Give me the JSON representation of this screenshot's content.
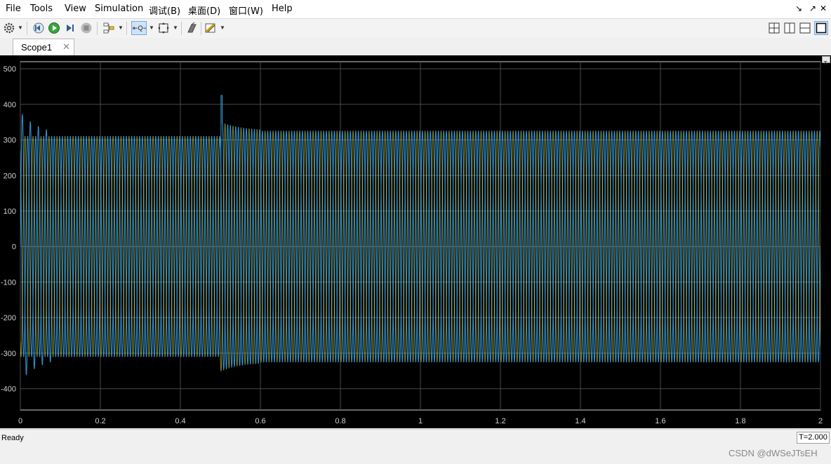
{
  "menu": [
    "File",
    "Tools",
    "View",
    "Simulation",
    "调试(B)",
    "桌面(D)",
    "窗口(W)",
    "Help"
  ],
  "window_controls": {
    "dock": "↘",
    "undock": "↗",
    "close": "✕"
  },
  "tab": {
    "label": "Scope1",
    "close": "✕"
  },
  "toolbar": {
    "icons": [
      "gear-icon",
      "step-back-icon",
      "run-icon",
      "step-forward-icon",
      "stop-icon",
      "signal-select-icon",
      "zoom-icon",
      "fit-to-view-icon",
      "highlight-block-icon",
      "measurements-icon"
    ],
    "layout_icons": [
      "layout-grid-icon",
      "layout-columns-icon",
      "layout-rows-icon",
      "layout-single-icon"
    ]
  },
  "status": {
    "text": "Ready",
    "time": "T=2.000"
  },
  "watermark": "CSDN @dWSeJTsEH",
  "colors": {
    "background": "#000000",
    "grid": "#4a4a4a",
    "axes_text": "#d0d0d0",
    "series_blue": "#3a9de0",
    "series_yellow": "#e8e040",
    "frame": "#f0f0f0"
  },
  "chart_data": {
    "type": "line",
    "title": "",
    "xlabel": "",
    "ylabel": "",
    "xlim": [
      0,
      2
    ],
    "ylim": [
      -460,
      520
    ],
    "xticks": [
      0,
      0.2,
      0.4,
      0.6,
      0.8,
      1,
      1.2,
      1.4,
      1.6,
      1.8,
      2
    ],
    "xtick_labels": [
      "0",
      "0.2",
      "0.4",
      "0.6",
      "0.8",
      "1",
      "1.2",
      "1.4",
      "1.6",
      "1.8",
      "2"
    ],
    "yticks": [
      500,
      400,
      300,
      200,
      100,
      0,
      -100,
      -200,
      -300,
      -400
    ],
    "ytick_labels": [
      "500",
      "400",
      "300",
      "200",
      "100",
      "0",
      "-100",
      "-200",
      "-300",
      "-400"
    ],
    "grid": true,
    "legend": "none",
    "series": [
      {
        "frequency_hz": 50,
        "phases": [
          {
            "t_start": 0,
            "t_end": 0.5,
            "amplitude": 310
          },
          {
            "t_start": 0.5,
            "t_end": 2,
            "amplitude": 325
          }
        ],
        "startup_peaks": [
          380,
          -360
        ],
        "disturbance_peak_at_0.5": 425,
        "color": "#3a9de0"
      },
      {
        "frequency_hz": 50,
        "phases": [
          {
            "t_start": 0,
            "t_end": 0.5,
            "amplitude": 310
          },
          {
            "t_start": 0.5,
            "t_end": 2,
            "amplitude": 325
          }
        ],
        "phase_offset_deg": 120,
        "color": "#3a9de0"
      },
      {
        "frequency_hz": 50,
        "phases": [
          {
            "t_start": 0,
            "t_end": 0.5,
            "amplitude": 310
          },
          {
            "t_start": 0.5,
            "t_end": 2,
            "amplitude": 325
          }
        ],
        "phase_offset_deg": 240,
        "color": "#e8e040"
      }
    ]
  }
}
